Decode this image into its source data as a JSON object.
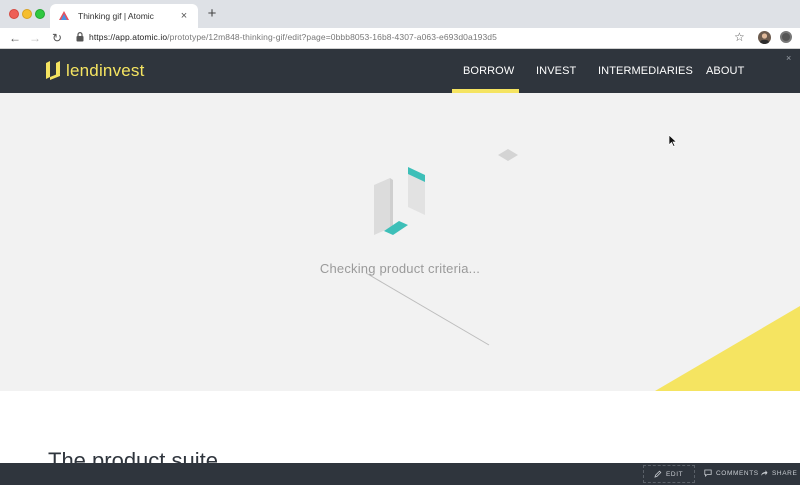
{
  "browser": {
    "tab_title": "Thinking gif | Atomic",
    "tab_close": "×",
    "new_tab": "+",
    "url_host": "https://app.atomic.io",
    "url_path": "/prototype/12m848-thinking-gif/edit?page=0bbb8053-16b8-4307-a063-e693d0a193d5",
    "back_icon": "←",
    "forward_icon": "→",
    "reload_icon": "↻",
    "star_icon": "☆"
  },
  "site": {
    "logo_text": "lendinvest",
    "brand_color": "#f5e461",
    "header_color": "#2f353d",
    "close_icon": "×",
    "nav": [
      {
        "label": "BORROW",
        "active": true
      },
      {
        "label": "INVEST",
        "active": false
      },
      {
        "label": "INTERMEDIARIES",
        "active": false
      },
      {
        "label": "ABOUT",
        "active": false
      }
    ]
  },
  "hero": {
    "loading_text": "Checking product criteria...",
    "accent_color": "#3dbfb8"
  },
  "content": {
    "section_title": "The product suite"
  },
  "atomic_bar": {
    "edit": "EDIT",
    "comments": "COMMENTS",
    "share": "SHARE"
  }
}
